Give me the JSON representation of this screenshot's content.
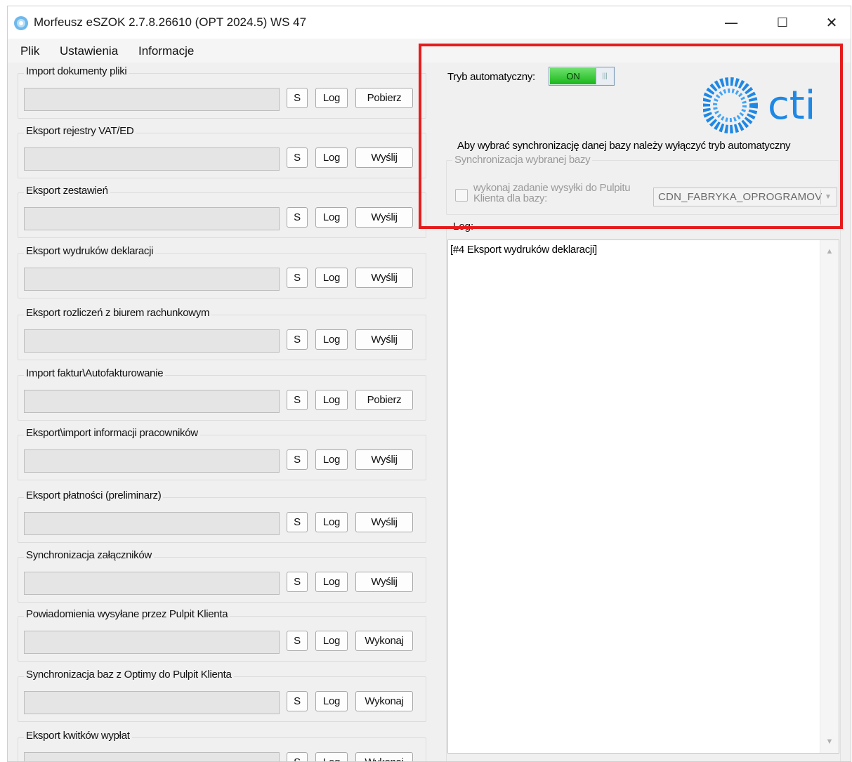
{
  "window": {
    "title": "Morfeusz eSZOK 2.7.8.26610 (OPT 2024.5) WS 47"
  },
  "window_controls": {
    "minimize": "—",
    "maximize": "☐",
    "close": "✕"
  },
  "menu": {
    "items": [
      "Plik",
      "Ustawienia",
      "Informacje"
    ]
  },
  "groups": [
    {
      "label": "Import dokumenty pliki",
      "s": "S",
      "log": "Log",
      "action": "Pobierz"
    },
    {
      "label": "Eksport rejestry VAT/ED",
      "s": "S",
      "log": "Log",
      "action": "Wyślij"
    },
    {
      "label": "Eksport zestawień",
      "s": "S",
      "log": "Log",
      "action": "Wyślij"
    },
    {
      "label": "Eksport wydruków deklaracji",
      "s": "S",
      "log": "Log",
      "action": "Wyślij"
    },
    {
      "label": "Eksport rozliczeń z biurem rachunkowym",
      "s": "S",
      "log": "Log",
      "action": "Wyślij"
    },
    {
      "label": "Import faktur\\Autofakturowanie",
      "s": "S",
      "log": "Log",
      "action": "Pobierz"
    },
    {
      "label": "Eksport\\import informacji pracowników",
      "s": "S",
      "log": "Log",
      "action": "Wyślij"
    },
    {
      "label": "Eksport płatności (preliminarz)",
      "s": "S",
      "log": "Log",
      "action": "Wyślij"
    },
    {
      "label": "Synchronizacja załączników",
      "s": "S",
      "log": "Log",
      "action": "Wyślij"
    },
    {
      "label": "Powiadomienia wysyłane przez Pulpit Klienta",
      "s": "S",
      "log": "Log",
      "action": "Wykonaj"
    },
    {
      "label": "Synchronizacja baz z Optimy do Pulpit Klienta",
      "s": "S",
      "log": "Log",
      "action": "Wykonaj"
    },
    {
      "label": "Eksport kwitków wypłat",
      "s": "S",
      "log": "Log",
      "action": "Wykonaj"
    }
  ],
  "auto_mode": {
    "label": "Tryb automatyczny:",
    "state": "ON",
    "knob": "|||"
  },
  "logo": {
    "text": "cti",
    "color": "#1e88e5"
  },
  "info_text": "Aby wybrać synchronizację danej bazy należy wyłączyć tryb automatyczny",
  "sync": {
    "group_label": "Synchronizacja wybranej bazy",
    "checkbox_label": "wykonaj zadanie wysyłki do Pulpitu Klienta dla bazy:",
    "checked": false,
    "database": "CDN_FABRYKA_OPROGRAMOV"
  },
  "log_panel": {
    "label": "Log:",
    "content": "[#4 Eksport wydruków deklaracji]"
  },
  "highlight_color": "#e61c1c"
}
